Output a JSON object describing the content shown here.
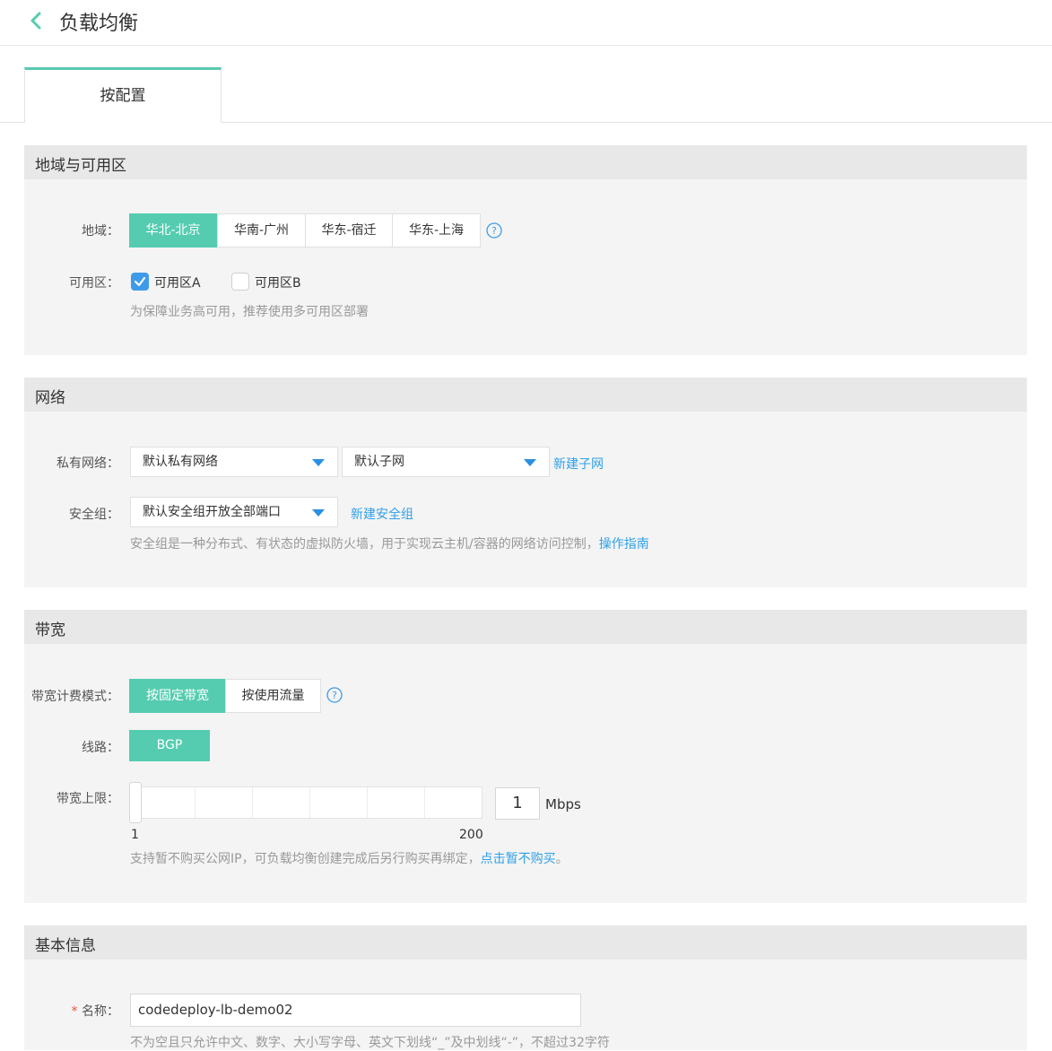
{
  "header": {
    "title": "负载均衡"
  },
  "tabs": [
    {
      "label": "按配置"
    }
  ],
  "colors": {
    "accent": "#55ccb0",
    "link": "#2fa0e8",
    "checkbox": "#3d9be9"
  },
  "region_section": {
    "title": "地域与可用区",
    "region_label": "地域：",
    "regions": [
      "华北-北京",
      "华南-广州",
      "华东-宿迁",
      "华东-上海"
    ],
    "selected_region": "华北-北京",
    "zone_label": "可用区：",
    "zones": [
      {
        "label": "可用区A",
        "checked": true
      },
      {
        "label": "可用区B",
        "checked": false
      }
    ],
    "zone_hint": "为保障业务高可用，推荐使用多可用区部署"
  },
  "network_section": {
    "title": "网络",
    "vpc_label": "私有网络：",
    "vpc_value": "默认私有网络",
    "subnet_value": "默认子网",
    "new_subnet_link": "新建子网",
    "sg_label": "安全组：",
    "sg_value": "默认安全组开放全部端口",
    "new_sg_link": "新建安全组",
    "sg_hint": "安全组是一种分布式、有状态的虚拟防火墙，用于实现云主机/容器的网络访问控制，",
    "sg_guide_link": "操作指南"
  },
  "bandwidth_section": {
    "title": "带宽",
    "billing_label": "带宽计费模式：",
    "billing_modes": [
      "按固定带宽",
      "按使用流量"
    ],
    "selected_billing": "按固定带宽",
    "line_label": "线路：",
    "line_value": "BGP",
    "limit_label": "带宽上限：",
    "limit_min": "1",
    "limit_max": "200",
    "limit_value": "1",
    "limit_unit": "Mbps",
    "hint": "支持暂不购买公网IP，可负载均衡创建完成后另行购买再绑定，",
    "no_buy_link": "点击暂不购买",
    "hint_end": "。"
  },
  "basic_section": {
    "title": "基本信息",
    "required_mark": "*",
    "name_label": "名称：",
    "name_value": "codedeploy-lb-demo02",
    "name_hint": "不为空且只允许中文、数字、大小写字母、英文下划线“_”及中划线“-”，不超过32字符"
  }
}
